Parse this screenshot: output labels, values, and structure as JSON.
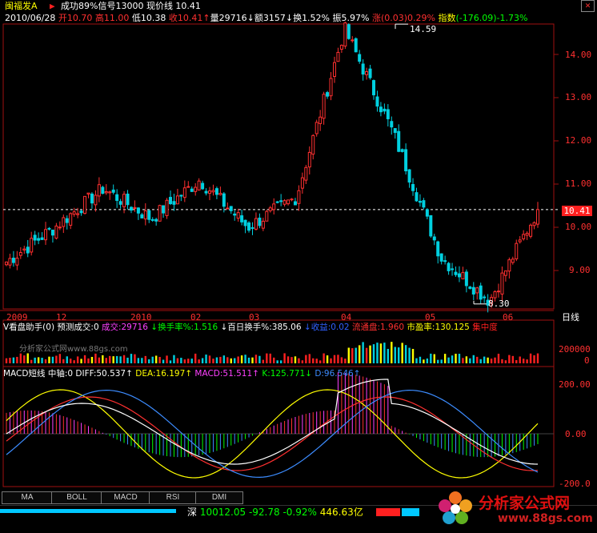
{
  "title": {
    "name": "闽福发A",
    "signal": "成功89%信号13000 现价线 10.41"
  },
  "quote": {
    "date": "2010/06/28",
    "open_label": "开",
    "open": "10.70",
    "high_label": "高",
    "high": "11.00",
    "low_label": "低",
    "low": "10.38",
    "close_label": "收",
    "close": "10.41",
    "volume_label": "量",
    "volume": "29716",
    "amount_label": "额",
    "amount": "3157",
    "turnover_label": "换",
    "turnover": "1.52%",
    "amplitude_label": "振",
    "amplitude": "5.97%",
    "change_label": "涨",
    "change": "(0.03)",
    "change_pct": "0.29%",
    "index_label": "指数",
    "index_value": "(-176.09)-1.73%"
  },
  "price_axis": {
    "ticks": [
      "14.00",
      "13.00",
      "12.00",
      "11.00",
      "10.00",
      "9.00"
    ],
    "current": "10.41"
  },
  "annotations": {
    "peak": "14.59",
    "trough": "8.30"
  },
  "time_axis": {
    "labels": [
      "2009",
      "12",
      "2010",
      "02",
      "03",
      "04",
      "05",
      "06"
    ],
    "period": "日线"
  },
  "vol_panel": {
    "name": "V看盘助手(0)",
    "predict": "预测成交:0",
    "items": [
      {
        "label": "成交:29716",
        "color": "#ff40ff"
      },
      {
        "label": "↓换手率%:1.516",
        "color": "#00ff00"
      },
      {
        "label": "↓百日换手%:385.06",
        "color": "#ffffff"
      },
      {
        "label": "↓收益:0.02",
        "color": "#3060ff"
      },
      {
        "label": "流通盘:1.960",
        "color": "#ff3030"
      },
      {
        "label": "市盈率:130.125",
        "color": "#ffff00"
      },
      {
        "label": "集中度",
        "color": "#ff2020"
      }
    ],
    "watermark": "分析家公式网www.88gs.com",
    "axis": [
      "200000",
      "0"
    ]
  },
  "macd_panel": {
    "name": "MACD短线",
    "axis_label": "中轴:0",
    "items": [
      {
        "label": "DIFF:50.537↑",
        "color": "#ffffff"
      },
      {
        "label": "DEA:16.197↑",
        "color": "#ffff00"
      },
      {
        "label": "MACD:51.511↑",
        "color": "#ff40ff"
      },
      {
        "label": "K:125.771↓",
        "color": "#00ff00"
      },
      {
        "label": "D:96.546↑",
        "color": "#3c8cff"
      }
    ],
    "axis": [
      "200.00",
      "0.00",
      "-200.0"
    ]
  },
  "tabs": [
    "MA",
    "BOLL",
    "MACD",
    "RSI",
    "DMI"
  ],
  "status": {
    "market": "深",
    "index": "10012.05",
    "change": "-92.78",
    "pct": "-0.92%",
    "amount": "446.63亿"
  },
  "logo": {
    "name": "分析家公式网",
    "url": "www.88gs.com"
  },
  "colors": {
    "up": "#ff3030",
    "down": "#00d0e0",
    "grid": "#a01010",
    "axis_text": "#ff3030"
  },
  "chart_data": {
    "type": "candlestick",
    "title": "闽福发A 日线",
    "ylim": [
      8.0,
      14.9
    ],
    "x": [
      "2009",
      "12",
      "2010",
      "02",
      "03",
      "04",
      "05",
      "06"
    ],
    "current_price": 10.41,
    "high_point": 14.59,
    "low_point": 8.3,
    "ohlc_keypoints": [
      {
        "t": "2009-11",
        "close": 9.2
      },
      {
        "t": "2009-12",
        "close": 10.0
      },
      {
        "t": "2010-01",
        "close": 10.9
      },
      {
        "t": "2010-02",
        "close": 10.2
      },
      {
        "t": "2010-03",
        "close": 11.1
      },
      {
        "t": "2010-03-late",
        "close": 10.0
      },
      {
        "t": "2010-04",
        "close": 10.7
      },
      {
        "t": "2010-04-peak",
        "close": 14.59
      },
      {
        "t": "2010-05",
        "close": 12.2
      },
      {
        "t": "2010-05-late",
        "close": 9.3
      },
      {
        "t": "2010-06-low",
        "close": 8.3
      },
      {
        "t": "2010-06-28",
        "close": 10.41
      }
    ]
  }
}
